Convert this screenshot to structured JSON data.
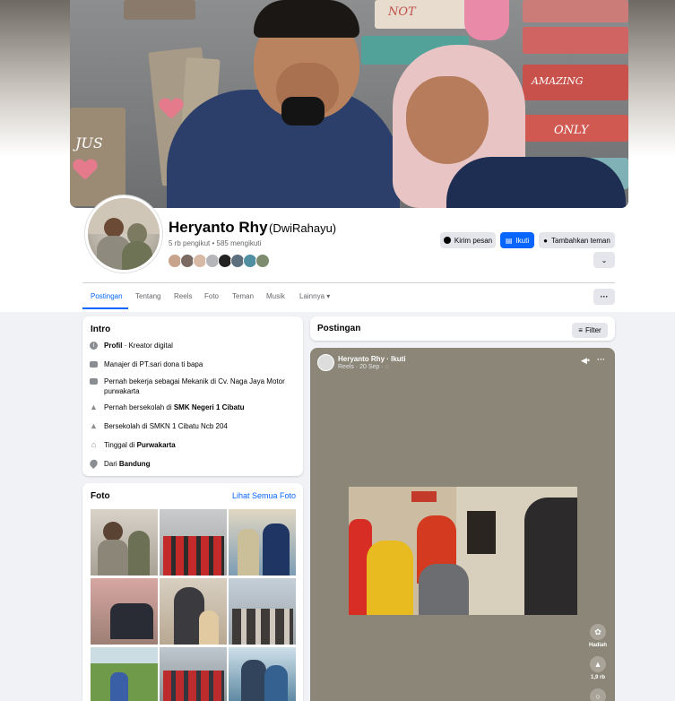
{
  "profile": {
    "name": "Heryanto Rhy",
    "alt_name": "(DwiRahayu)",
    "counts": "5 rb pengikut • 585 mengikuti"
  },
  "actions": {
    "message": "Kirim pesan",
    "follow": "Ikuti",
    "add_friend": "Tambahkan teman"
  },
  "tabs": [
    "Postingan",
    "Tentang",
    "Reels",
    "Foto",
    "Teman",
    "Musik",
    "Lainnya ▾"
  ],
  "intro": {
    "title": "Intro",
    "profile_label": "Profil",
    "profile_rest": " · Kreator digital",
    "job": "Manajer di PT.sari dona ti bapa",
    "past_job": "Pernah bekerja sebagai Mekanik di Cv. Naga Jaya Motor purwakarta",
    "school1_prefix": "Pernah bersekolah di ",
    "school1_name": "SMK Negeri 1 Cibatu",
    "school2": "Bersekolah di SMKN 1 Cibatu Ncb 204",
    "lives_prefix": "Tinggal di ",
    "lives_city": "Purwakarta",
    "from_prefix": "Dari ",
    "from_city": "Bandung"
  },
  "photos": {
    "title": "Foto",
    "see_all": "Lihat Semua Foto"
  },
  "posts": {
    "title": "Postingan",
    "filter": "Filter"
  },
  "reel": {
    "author": "Heryanto Rhy · Ikuti",
    "meta": "Reels · 20 Sep · ◌",
    "gift_label": "Hadiah",
    "likes": "1,9 rb"
  },
  "icons": [
    "messenger-icon",
    "follow-icon",
    "add-friend-icon",
    "chevron-down-icon",
    "more-icon",
    "info-icon",
    "briefcase-icon",
    "graduation-cap-icon",
    "home-icon",
    "location-pin-icon",
    "filter-icon",
    "mute-icon",
    "gift-icon",
    "like-icon",
    "comment-icon"
  ],
  "colors": {
    "accent": "#0866ff",
    "page_bg": "#f0f2f5",
    "reel_bg": "#8b8677"
  }
}
